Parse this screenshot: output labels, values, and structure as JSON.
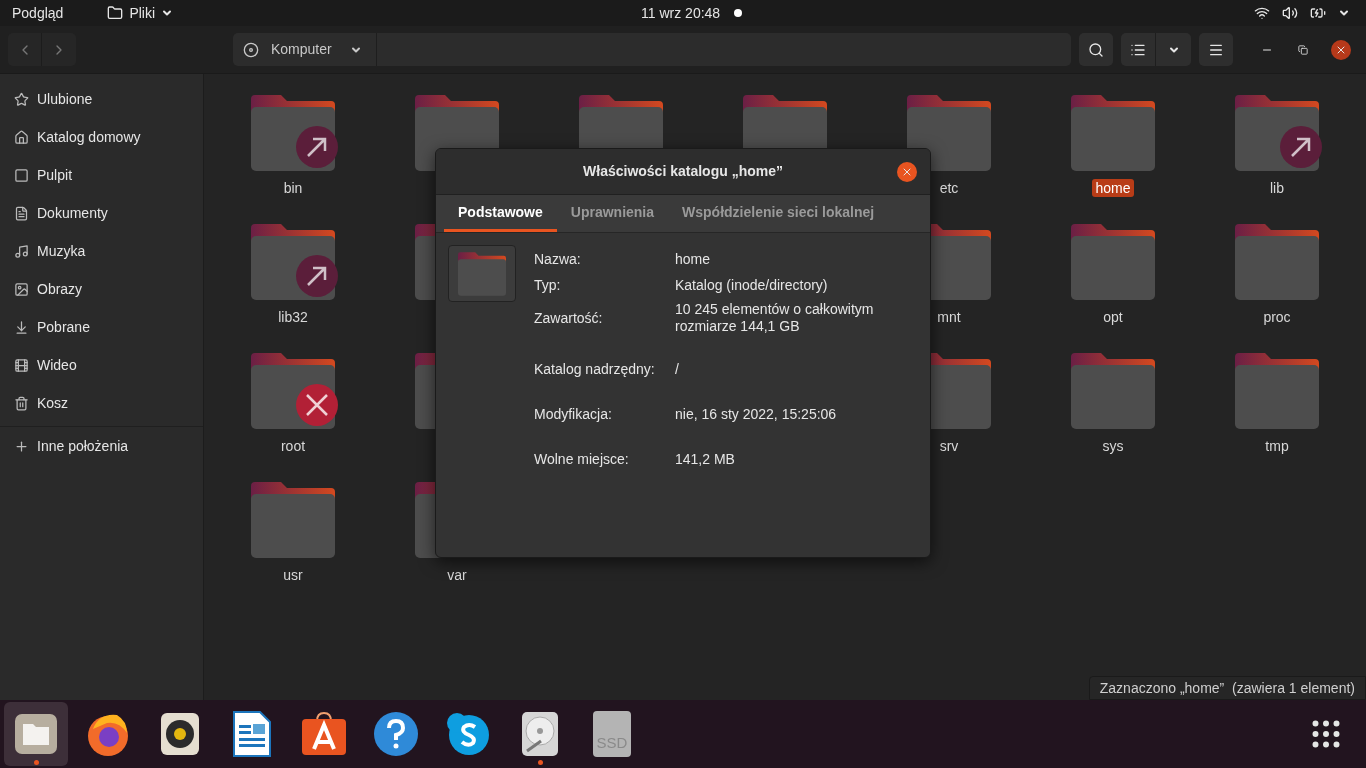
{
  "top_bar": {
    "activities": "Podgląd",
    "app_menu": "Pliki",
    "date": "11 wrz",
    "time": "20:48"
  },
  "header": {
    "location": "Komputer"
  },
  "sidebar": {
    "items": [
      {
        "kind": "star",
        "label": "Ulubione",
        "selected": false
      },
      {
        "kind": "home",
        "label": "Katalog domowy",
        "selected": false
      },
      {
        "kind": "desktop",
        "label": "Pulpit",
        "selected": false
      },
      {
        "kind": "document",
        "label": "Dokumenty",
        "selected": false
      },
      {
        "kind": "music",
        "label": "Muzyka",
        "selected": false
      },
      {
        "kind": "image",
        "label": "Obrazy",
        "selected": false
      },
      {
        "kind": "download",
        "label": "Pobrane",
        "selected": false
      },
      {
        "kind": "video",
        "label": "Wideo",
        "selected": false
      },
      {
        "kind": "trash",
        "label": "Kosz",
        "selected": false
      }
    ],
    "other": "Inne położenia"
  },
  "folders": [
    {
      "kind": "link",
      "name": "bin",
      "selected": false
    },
    {
      "kind": "hidden"
    },
    {
      "kind": "hidden"
    },
    {
      "kind": "hidden"
    },
    {
      "kind": "plain",
      "name": "etc",
      "selected": false
    },
    {
      "kind": "plain",
      "name": "home",
      "selected": true
    },
    {
      "kind": "link",
      "name": "lib",
      "selected": false
    },
    {
      "kind": "link",
      "name": "lib32",
      "selected": false
    },
    {
      "kind": "hidden"
    },
    {
      "kind": "covered"
    },
    {
      "kind": "covered"
    },
    {
      "kind": "plain",
      "name": "mnt",
      "selected": false
    },
    {
      "kind": "plain",
      "name": "opt",
      "selected": false
    },
    {
      "kind": "plain",
      "name": "proc",
      "selected": false
    },
    {
      "kind": "locked",
      "name": "root",
      "selected": false
    },
    {
      "kind": "hidden"
    },
    {
      "kind": "covered"
    },
    {
      "kind": "covered"
    },
    {
      "kind": "plain",
      "name": "srv",
      "selected": false
    },
    {
      "kind": "plain",
      "name": "sys",
      "selected": false
    },
    {
      "kind": "plain",
      "name": "tmp",
      "selected": false
    },
    {
      "kind": "plain",
      "name": "usr",
      "selected": false
    },
    {
      "kind": "plain",
      "name": "var",
      "selected": false
    }
  ],
  "dialog": {
    "title": "Właściwości katalogu „home”",
    "tabs": [
      {
        "label": "Podstawowe",
        "selected": true
      },
      {
        "label": "Uprawnienia",
        "selected": false
      },
      {
        "label": "Współdzielenie sieci lokalnej",
        "selected": false
      }
    ],
    "sections": [
      [
        {
          "label": "Nazwa:",
          "value": "home"
        },
        {
          "label": "Typ:",
          "value": "Katalog (inode/directory)"
        },
        {
          "label": "Zawartość:",
          "value": "10 245 elementów o całkowitym rozmiarze 144,1 GB"
        }
      ],
      [
        {
          "label": "Katalog nadrzędny:",
          "value": "/"
        }
      ],
      [
        {
          "label": "Modyfikacja:",
          "value": "nie, 16 sty 2022, 15:25:06"
        }
      ],
      [
        {
          "label": "Wolne miejsce:",
          "value": "141,2 MB"
        }
      ]
    ]
  },
  "status_bar": "Zaznaczono „home”  (zawiera 1 element)",
  "dock": {
    "apps": [
      {
        "kind": "files",
        "selected": true,
        "running": true
      },
      {
        "kind": "browser",
        "selected": false,
        "running": false
      },
      {
        "kind": "speaker",
        "selected": false,
        "running": false
      },
      {
        "kind": "writer",
        "selected": false,
        "running": false
      },
      {
        "kind": "store",
        "selected": false,
        "running": false
      },
      {
        "kind": "help",
        "selected": false,
        "running": false
      },
      {
        "kind": "chat",
        "selected": false,
        "running": false
      },
      {
        "kind": "disks",
        "selected": false,
        "running": true
      },
      {
        "kind": "ssd",
        "label": "SSD",
        "selected": false,
        "running": false
      }
    ]
  }
}
